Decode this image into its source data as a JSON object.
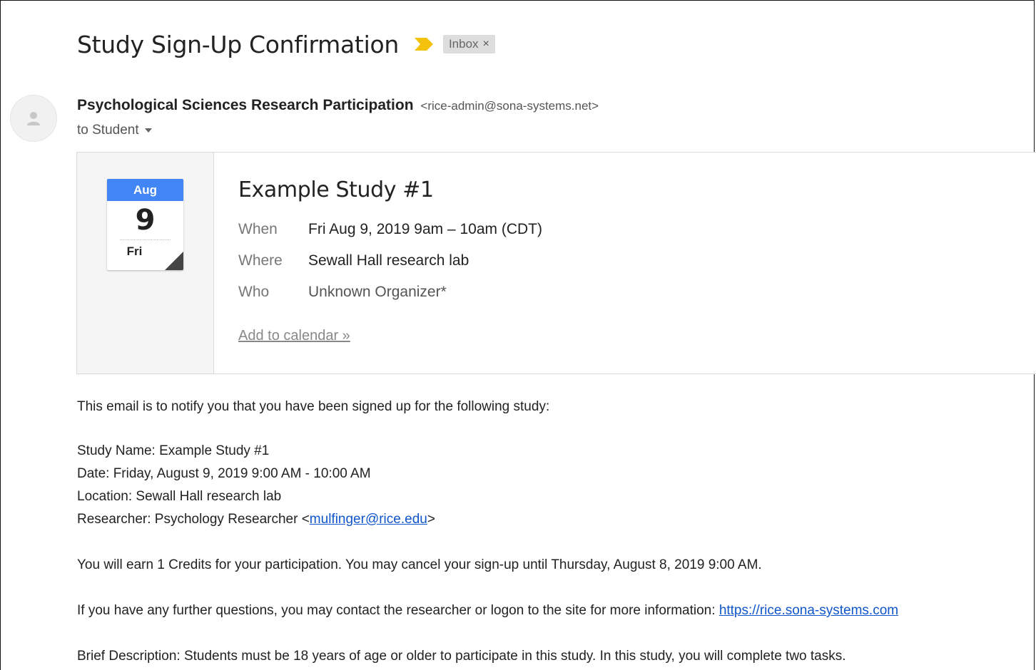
{
  "subject": "Study Sign-Up Confirmation",
  "label": {
    "text": "Inbox",
    "remove_glyph": "×"
  },
  "icons": {
    "importance": "importance-marker-icon",
    "avatar": "person-icon",
    "caret": "caret-down-icon",
    "calendar": "calendar-icon"
  },
  "colors": {
    "importance": "#f4c20d",
    "calendar_month": "#4285f4",
    "link": "#1155cc"
  },
  "sender": {
    "name": "Psychological Sciences Research Participation",
    "email": "<rice-admin@sona-systems.net>"
  },
  "recipient": "to Student",
  "event": {
    "month": "Aug",
    "day": "9",
    "weekday": "Fri",
    "title": "Example Study #1",
    "when_label": "When",
    "when_value": "Fri Aug 9, 2019 9am – 10am (CDT)",
    "where_label": "Where",
    "where_value": "Sewall Hall research lab",
    "who_label": "Who",
    "who_value": "Unknown Organizer*",
    "add_calendar": "Add to calendar »"
  },
  "body": {
    "intro": "This email is to notify you that you have been signed up for the following study:",
    "study_name": "Study Name: Example Study #1",
    "date": "Date: Friday, August 9, 2019 9:00 AM - 10:00 AM",
    "location": "Location: Sewall Hall research lab",
    "researcher_prefix": "Researcher: Psychology Researcher <",
    "researcher_email": "mulfinger@rice.edu",
    "researcher_suffix": ">",
    "credits": "You will earn 1 Credits for your participation. You may cancel your sign-up until Thursday, August 8, 2019 9:00 AM.",
    "questions_prefix": "If you have any further questions, you may contact the researcher or logon to the site for more information: ",
    "site_link": "https://rice.sona-systems.com",
    "description": "Brief Description: Students must be 18 years of age or older to participate in this study. In this study, you will complete two tasks."
  }
}
